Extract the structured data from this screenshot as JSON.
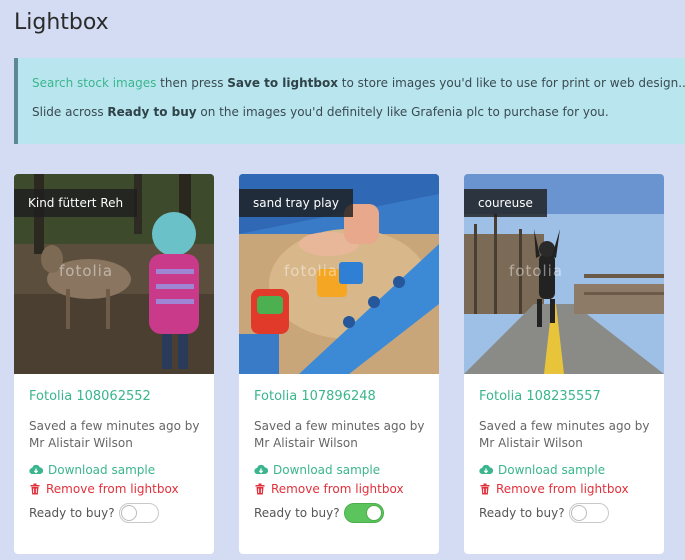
{
  "page": {
    "title": "Lightbox"
  },
  "info": {
    "line1": {
      "link": "Search stock images",
      "text1": " then press ",
      "bold": "Save to lightbox",
      "text2": " to store images you'd like to use for print or web design.."
    },
    "line2": {
      "text1": "Slide across ",
      "bold": "Ready to buy",
      "text2": " on the images you'd definitely like Grafenia plc to purchase for you."
    }
  },
  "common": {
    "watermark": "fotolia",
    "download_label": "Download sample",
    "remove_label": "Remove from lightbox",
    "ready_label": "Ready to buy?"
  },
  "cards": [
    {
      "tag": "Kind füttert Reh",
      "id": "Fotolia 108062552",
      "saved_line1": "Saved a few minutes ago by",
      "saved_line2": "Mr Alistair Wilson",
      "ready": false
    },
    {
      "tag": "sand tray play",
      "id": "Fotolia 107896248",
      "saved_line1": "Saved a few minutes ago by",
      "saved_line2": "Mr Alistair Wilson",
      "ready": true
    },
    {
      "tag": "coureuse",
      "id": "Fotolia 108235557",
      "saved_line1": "Saved a few minutes ago by",
      "saved_line2": "Mr Alistair Wilson",
      "ready": false
    }
  ],
  "colors": {
    "accent": "#3bb58e",
    "danger": "#e0313c",
    "toggle_on": "#5cc45c",
    "info_bg": "#b9e6ee",
    "page_bg": "#d3dcf2"
  },
  "icons": {
    "download": "cloud-download-icon",
    "remove": "trash-icon"
  }
}
